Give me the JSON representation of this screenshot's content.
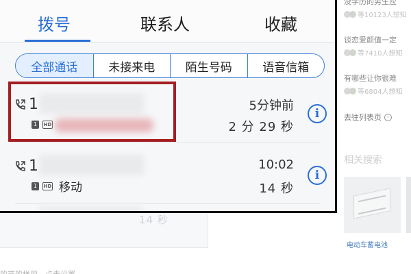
{
  "sidebar": {
    "questions": [
      {
        "title": "没学历的男生应",
        "meta": "等10123人想知"
      },
      {
        "title": "谈恋爱颜值一定",
        "meta": "等7410人想知"
      },
      {
        "title": "有哪些让你很难",
        "meta": "等6804人想知"
      }
    ],
    "more_label": "去往列表页",
    "related_title": "相关搜索",
    "thumb_caption": "电动车蓄电池"
  },
  "underlay": {
    "duration": "14 秒",
    "footer": "的节的样用，点击设置"
  },
  "phone": {
    "tabs": [
      {
        "label": "拨号",
        "active": true
      },
      {
        "label": "联系人",
        "active": false
      },
      {
        "label": "收藏",
        "active": false
      }
    ],
    "filters": [
      {
        "label": "全部通话",
        "active": true
      },
      {
        "label": "未接来电",
        "active": false
      },
      {
        "label": "陌生号码",
        "active": false
      },
      {
        "label": "语音信箱",
        "active": false
      }
    ],
    "calls": [
      {
        "number_prefix": "1",
        "location": "",
        "time": "5分钟前",
        "duration": "2 分 29 秒",
        "highlighted": true
      },
      {
        "number_prefix": "1",
        "location": "移动",
        "time": "10:02",
        "duration": "14 秒",
        "highlighted": false
      }
    ],
    "icons": {
      "call": "outgoing-call-icon",
      "sim": "sim-card-icon",
      "hd": "hd-voice-icon",
      "info": "info-icon"
    },
    "badges": {
      "sim": "1",
      "hd": "HD"
    },
    "info_glyph": "i",
    "colors": {
      "accent": "#2a6fd6",
      "highlight_border": "#a51e22"
    }
  }
}
